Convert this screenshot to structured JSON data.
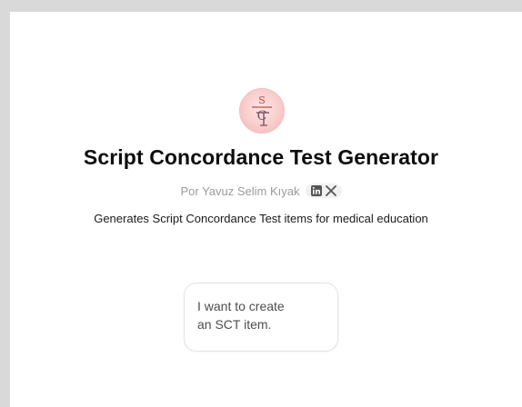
{
  "gpt": {
    "logo_icon": "sct-logo-icon",
    "title": "Script Concordance Test Generator",
    "author": "Por Yavuz Selim Kıyak",
    "social": [
      "linkedin-icon",
      "x-icon"
    ],
    "description": "Generates Script Concordance Test items for medical education"
  },
  "conversation_starters": [
    {
      "line1": "I want to create",
      "line2": "an SCT item."
    }
  ],
  "colors": {
    "background": "#d9d9d9",
    "panel": "#ffffff",
    "logo_bg": "#f9cccc",
    "muted_text": "#9b9b9b"
  }
}
